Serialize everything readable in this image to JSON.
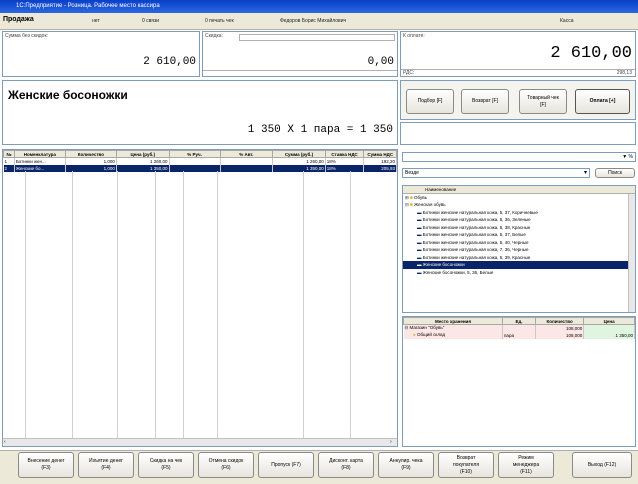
{
  "window": {
    "title": "1С:Предприятие - Розница. Рабочее место кассира"
  },
  "header": {
    "mode": "Продажа",
    "field1": "нет",
    "field2": "0 связи",
    "field3": "0 печать чек",
    "user": "Федоров Борис Михайлович",
    "right": "Касса"
  },
  "totals": {
    "sum_no_discount_label": "Сумма без скидок:",
    "sum_no_discount_value": "2 610,00",
    "discount_label": "Скидка:",
    "discount_value": "0,00",
    "to_pay_label": "К оплате:",
    "to_pay_value": "2 610,00",
    "to_pay_sub_left": "РДС:",
    "to_pay_sub_right": "298,13"
  },
  "product": {
    "name": "Женские босоножки",
    "calc": "1 350 X 1 пара = 1 350"
  },
  "action_buttons": [
    {
      "label": "Подбор [F]"
    },
    {
      "label": "Возврат [F]"
    },
    {
      "label": "Товарный чек\n[F]"
    },
    {
      "label": "Оплата [+]"
    }
  ],
  "table": {
    "columns": [
      "№",
      "Номенклатура",
      "Количество",
      "Цена (руб.)",
      "% Руч.",
      "% Авт.",
      "Сумма (руб.)",
      "Ставка НДС",
      "Сумма НДС"
    ],
    "rows": [
      [
        "1",
        "Ботинки жен...",
        "1,000",
        "1 260,00",
        "",
        "",
        "1 260,00",
        "18%",
        "192,20"
      ],
      [
        "2",
        "Женские бо...",
        "1,000",
        "1 350,00",
        "",
        "",
        "1 350,00",
        "18%",
        "205,93"
      ]
    ]
  },
  "search": {
    "value": "",
    "suffix": "▼ %",
    "filter_value": "Везде",
    "find_button": "Поиск"
  },
  "tree": {
    "header": "Наименование",
    "groups": [
      "Обувь",
      "Женская обувь"
    ],
    "items": [
      "Ботинки женские натуральная кожа, 5, 37, Коричневые",
      "Ботинки женские натуральная кожа, 5, 36, Зеленые",
      "Ботинки женские натуральная кожа, 5, 38, Красные",
      "Ботинки женские натуральная кожа, 5, 37, Белые",
      "Ботинки женские натуральная кожа, 5, 40, Черные",
      "Ботинки женские натуральная кожа, 7, 36, Черные",
      "Ботинки женские натуральная кожа, 5, 39, Красные",
      "Женские босоножки",
      "Женские босоножки, 5, 36, Белые"
    ],
    "selected_index": 7
  },
  "stock": {
    "columns": [
      "Место хранения",
      "Ед.",
      "Количество",
      "Цена"
    ],
    "rows": [
      [
        "Магазин \"Обувь\"",
        "",
        "108,000",
        ""
      ],
      [
        "Общий склад",
        "пара",
        "108,000",
        "1 350,00"
      ]
    ]
  },
  "bottom_buttons": [
    {
      "label": "Внесение денег\n(F3)"
    },
    {
      "label": "Изъятие денег\n(F4)"
    },
    {
      "label": "Скидка на чек\n(F5)"
    },
    {
      "label": "Отмена скидок\n(F6)"
    },
    {
      "label": "Пропуск (F7)"
    },
    {
      "label": "Дисконт. карта\n(F8)"
    },
    {
      "label": "Аннулир. чека\n(F9)"
    },
    {
      "label": "Возврат\nпокупателя\n(F10)"
    },
    {
      "label": "Режим\nменеджера\n(F11)"
    },
    {
      "label": "Выход (F12)"
    }
  ],
  "colors": {
    "selection": "#0a246a",
    "titlebar": "#0a3fc8",
    "chrome": "#ece9d8"
  }
}
